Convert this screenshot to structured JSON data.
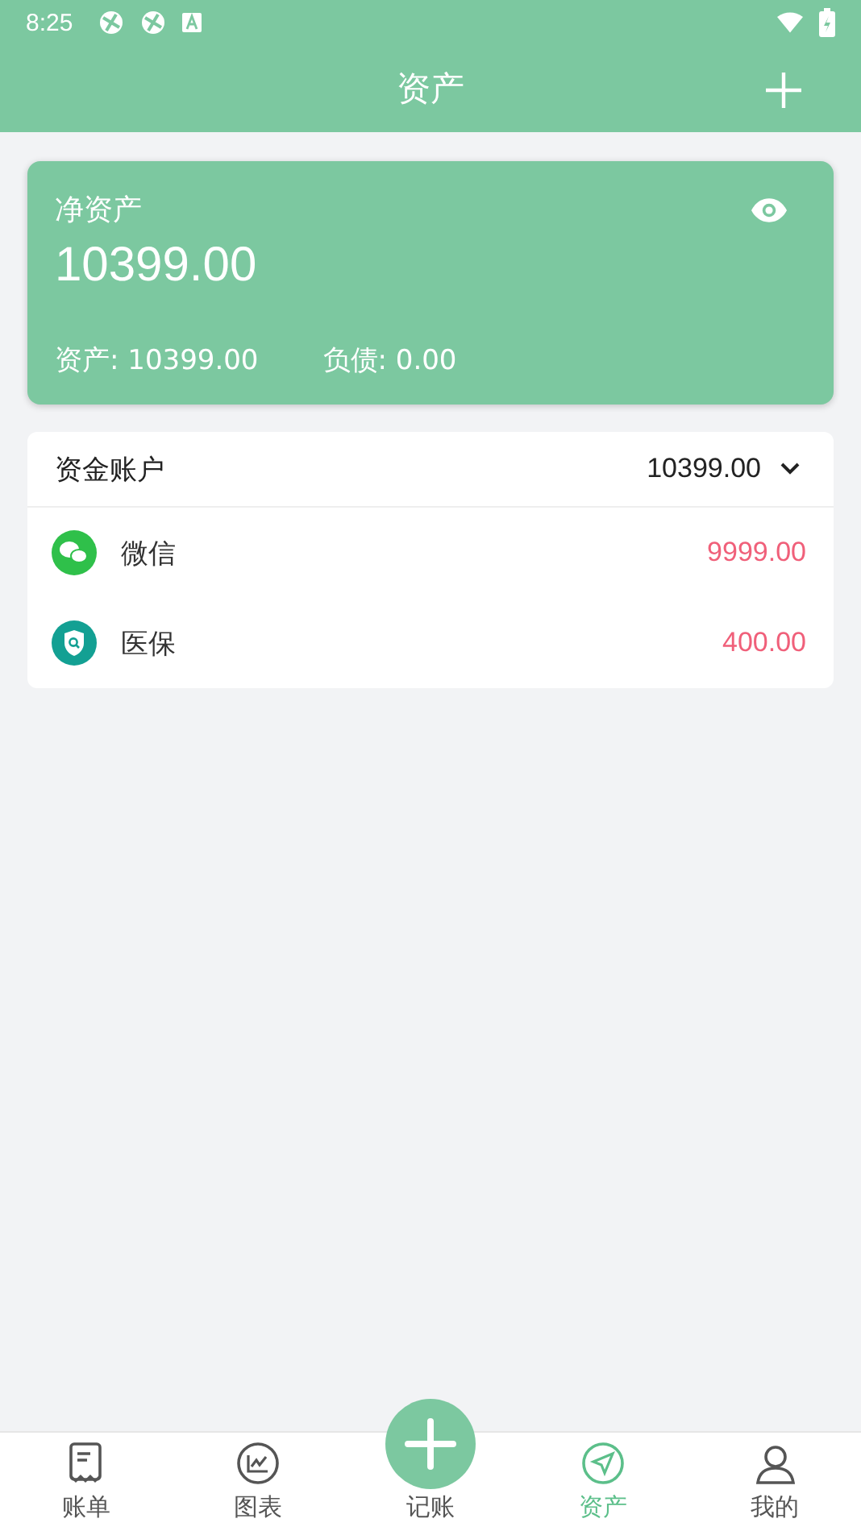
{
  "status_bar": {
    "time": "8:25"
  },
  "app_bar": {
    "title": "资产"
  },
  "net_card": {
    "label": "净资产",
    "amount": "10399.00",
    "assets": "资产: 10399.00",
    "liabilities": "负债: 0.00"
  },
  "account_group": {
    "title": "资金账户",
    "total": "10399.00",
    "expanded": true,
    "accounts": [
      {
        "kind": "chat",
        "name": "微信",
        "amount": "9999.00",
        "color": "#2fc04a"
      },
      {
        "kind": "shield",
        "name": "医保",
        "amount": "400.00",
        "color": "#13a093"
      }
    ]
  },
  "bottom_nav": [
    {
      "kind": "bill",
      "label": "账单",
      "selected": false
    },
    {
      "kind": "chart",
      "label": "图表",
      "selected": false
    },
    {
      "kind": "add",
      "label": "记账",
      "selected": false
    },
    {
      "kind": "assets",
      "label": "资产",
      "selected": true
    },
    {
      "kind": "me",
      "label": "我的",
      "selected": false
    }
  ]
}
